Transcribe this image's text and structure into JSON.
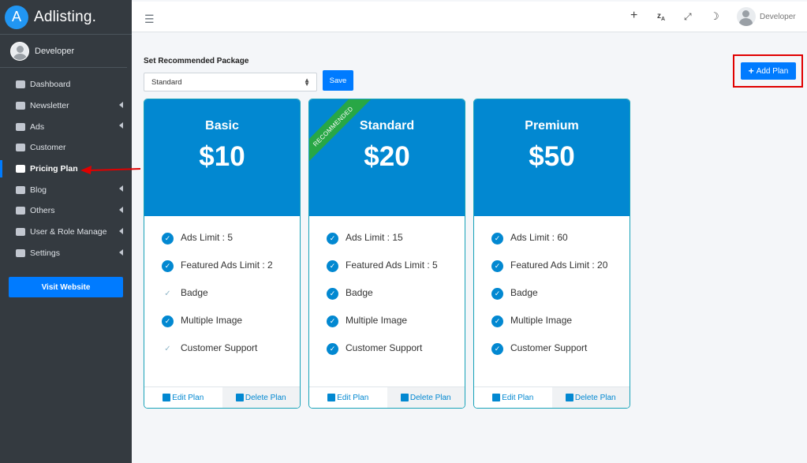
{
  "brand": {
    "logo_letter": "A",
    "name": "Adlisting."
  },
  "sidebar": {
    "user": "Developer",
    "items": [
      {
        "label": "Dashboard",
        "icon": "dashboard-icon",
        "has_caret": false,
        "active": false
      },
      {
        "label": "Newsletter",
        "icon": "envelope-icon",
        "has_caret": true,
        "active": false
      },
      {
        "label": "Ads",
        "icon": "ad-icon",
        "has_caret": true,
        "active": false
      },
      {
        "label": "Customer",
        "icon": "user-icon",
        "has_caret": false,
        "active": false
      },
      {
        "label": "Pricing Plan",
        "icon": "credit-card-icon",
        "has_caret": false,
        "active": true
      },
      {
        "label": "Blog",
        "icon": "blog-icon",
        "has_caret": true,
        "active": false
      },
      {
        "label": "Others",
        "icon": "list-icon",
        "has_caret": true,
        "active": false
      },
      {
        "label": "User & Role Manage",
        "icon": "lock-icon",
        "has_caret": true,
        "active": false
      },
      {
        "label": "Settings",
        "icon": "gear-icon",
        "has_caret": true,
        "active": false
      }
    ],
    "visit_button": "Visit Website"
  },
  "topnav": {
    "icons": [
      "hamburger-icon",
      "plus-icon",
      "translate-icon",
      "fullscreen-icon",
      "moon-icon"
    ],
    "user": "Developer"
  },
  "recommend": {
    "label": "Set Recommended Package",
    "selected": "Standard",
    "save_label": "Save"
  },
  "add_plan_label": "Add Plan",
  "plans": [
    {
      "name": "Basic",
      "price": "$10",
      "recommended": false,
      "features": [
        {
          "text": "Ads Limit : 5",
          "enabled": true
        },
        {
          "text": "Featured Ads Limit : 2",
          "enabled": true
        },
        {
          "text": "Badge",
          "enabled": false
        },
        {
          "text": "Multiple Image",
          "enabled": true
        },
        {
          "text": "Customer Support",
          "enabled": false
        }
      ],
      "edit_label": "Edit Plan",
      "delete_label": "Delete Plan"
    },
    {
      "name": "Standard",
      "price": "$20",
      "recommended": true,
      "ribbon_label": "RECOMMENDED",
      "features": [
        {
          "text": "Ads Limit : 15",
          "enabled": true
        },
        {
          "text": "Featured Ads Limit : 5",
          "enabled": true
        },
        {
          "text": "Badge",
          "enabled": true
        },
        {
          "text": "Multiple Image",
          "enabled": true
        },
        {
          "text": "Customer Support",
          "enabled": true
        }
      ],
      "edit_label": "Edit Plan",
      "delete_label": "Delete Plan"
    },
    {
      "name": "Premium",
      "price": "$50",
      "recommended": false,
      "features": [
        {
          "text": "Ads Limit : 60",
          "enabled": true
        },
        {
          "text": "Featured Ads Limit : 20",
          "enabled": true
        },
        {
          "text": "Badge",
          "enabled": true
        },
        {
          "text": "Multiple Image",
          "enabled": true
        },
        {
          "text": "Customer Support",
          "enabled": true
        }
      ],
      "edit_label": "Edit Plan",
      "delete_label": "Delete Plan"
    }
  ],
  "colors": {
    "primary": "#007bff",
    "card_header": "#0288d1",
    "ribbon": "#28a745",
    "highlight": "#e00000",
    "sidebar": "#343a40"
  }
}
